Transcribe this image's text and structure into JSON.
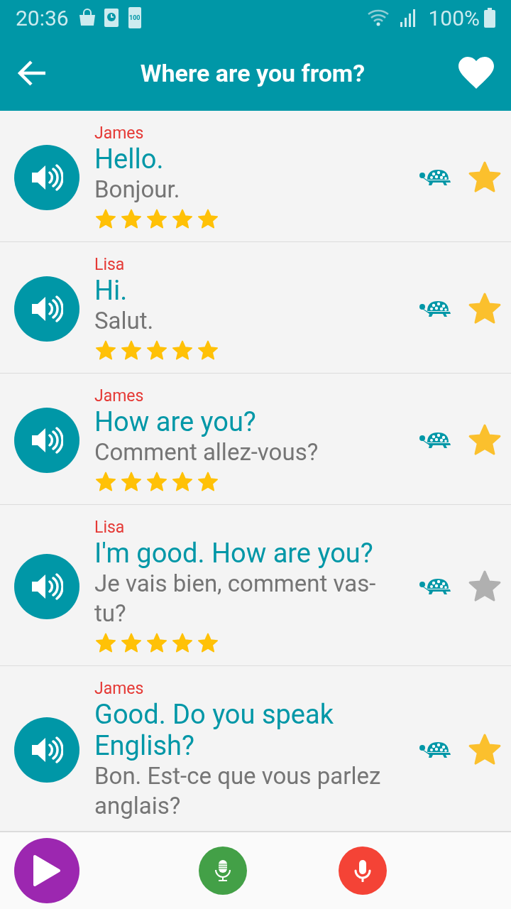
{
  "status_bar": {
    "time": "20:36",
    "battery_icon_label": "100",
    "battery": "100%"
  },
  "header": {
    "title": "Where are you from?"
  },
  "phrases": [
    {
      "speaker": "James",
      "text": "Hello.",
      "translation": "Bonjour.",
      "stars": 5,
      "favorite": true
    },
    {
      "speaker": "Lisa",
      "text": "Hi.",
      "translation": "Salut.",
      "stars": 5,
      "favorite": true
    },
    {
      "speaker": "James",
      "text": "How are you?",
      "translation": "Comment allez-vous?",
      "stars": 5,
      "favorite": true
    },
    {
      "speaker": "Lisa",
      "text": "I'm good. How are you?",
      "translation": "Je vais bien, comment vas-tu?",
      "stars": 5,
      "favorite": false
    },
    {
      "speaker": "James",
      "text": "Good. Do you speak English?",
      "translation": "Bon. Est-ce que vous parlez anglais?",
      "favorite": true
    }
  ]
}
